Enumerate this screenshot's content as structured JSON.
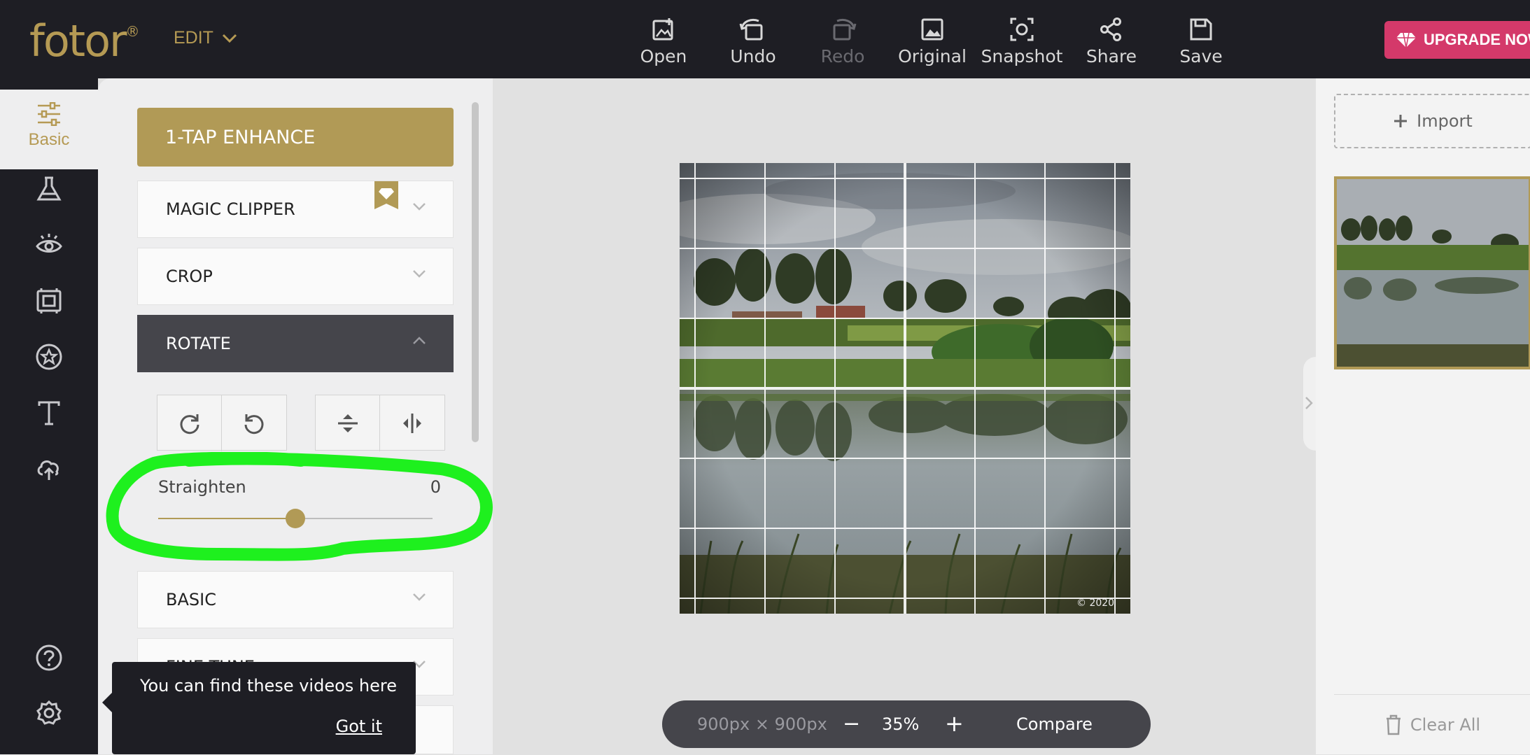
{
  "app": {
    "logo_text": "fotor",
    "logo_mark": "®",
    "menu_label": "EDIT",
    "upgrade_label": "UPGRADE NOW",
    "accent_color": "#b19a56",
    "upgrade_color": "#d4396a"
  },
  "toolbar": {
    "open": "Open",
    "undo": "Undo",
    "redo": "Redo",
    "original": "Original",
    "snapshot": "Snapshot",
    "share": "Share",
    "save": "Save"
  },
  "sidebar": {
    "active_label": "Basic",
    "icons": [
      "basic-sliders-icon",
      "flask-icon",
      "eye-icon",
      "frame-icon",
      "sticker-star-icon",
      "text-icon",
      "cloud-upload-icon",
      "help-icon",
      "settings-icon"
    ]
  },
  "panel": {
    "enhance": "1-TAP ENHANCE",
    "sections": {
      "magic_clipper": "MAGIC CLIPPER",
      "crop": "CROP",
      "rotate": "ROTATE",
      "basic": "BASIC",
      "fine_tune": "FINE TUNE"
    },
    "straighten": {
      "label": "Straighten",
      "value": "0",
      "position_fraction": 0.5
    }
  },
  "tooltip": {
    "message": "You can find these videos here",
    "button": "Got it"
  },
  "canvas": {
    "image_size": "900px × 900px",
    "zoom": "35%",
    "compare": "Compare",
    "minus": "−",
    "plus": "+",
    "watermark": "©  2020"
  },
  "right_panel": {
    "import": "Import",
    "clear_all": "Clear All"
  }
}
